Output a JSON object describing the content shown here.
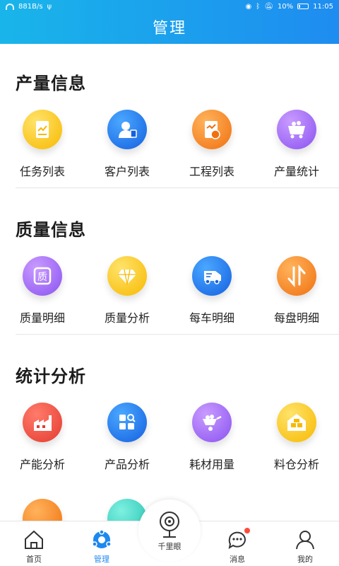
{
  "status": {
    "speed": "881B/s",
    "battery": "10%",
    "time": "11:05"
  },
  "header": {
    "title": "管理"
  },
  "sections": [
    {
      "title": "产量信息",
      "items": [
        {
          "label": "任务列表",
          "icon": "task-list-icon",
          "color": "#f7b900"
        },
        {
          "label": "客户列表",
          "icon": "customer-icon",
          "color": "#1560e0"
        },
        {
          "label": "工程列表",
          "icon": "project-icon",
          "color": "#f0700f"
        },
        {
          "label": "产量统计",
          "icon": "mine-cart-icon",
          "color": "#8a52f0"
        }
      ]
    },
    {
      "title": "质量信息",
      "items": [
        {
          "label": "质量明细",
          "icon": "quality-badge-icon",
          "color": "#8a52f0"
        },
        {
          "label": "质量分析",
          "icon": "diamond-icon",
          "color": "#f7b900"
        },
        {
          "label": "每车明细",
          "icon": "truck-icon",
          "color": "#1560e0"
        },
        {
          "label": "每盘明细",
          "icon": "transfer-arrows-icon",
          "color": "#f0700f"
        }
      ]
    },
    {
      "title": "统计分析",
      "items": [
        {
          "label": "产能分析",
          "icon": "factory-icon",
          "color": "#e43b30"
        },
        {
          "label": "产品分析",
          "icon": "grid-search-icon",
          "color": "#1560e0"
        },
        {
          "label": "耗材用量",
          "icon": "wheelbarrow-icon",
          "color": "#8a52f0"
        },
        {
          "label": "料仓分析",
          "icon": "warehouse-icon",
          "color": "#f7b900"
        }
      ]
    }
  ],
  "tabbar": {
    "items": [
      {
        "label": "首页",
        "icon": "home-icon",
        "active": false
      },
      {
        "label": "管理",
        "icon": "manage-icon",
        "active": true
      },
      {
        "label": "千里眼",
        "icon": "camera-icon",
        "active": false
      },
      {
        "label": "消息",
        "icon": "message-icon",
        "active": false
      },
      {
        "label": "我的",
        "icon": "user-icon",
        "active": false
      }
    ],
    "active_color": "#1e88f0",
    "badge_color": "#ff4b3a"
  }
}
